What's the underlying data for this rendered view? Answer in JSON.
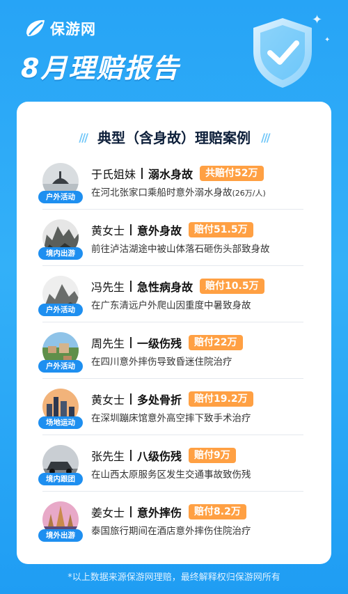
{
  "brand": {
    "name": "保游网"
  },
  "header": {
    "title": "8月理赔报告"
  },
  "section": {
    "title": "典型（含身故）理赔案例"
  },
  "cases": [
    {
      "name": "于氏姐妹",
      "cause": "溺水身故",
      "amount": "共赔付52万",
      "desc": "在河北张家口乘船时意外溺水身故",
      "note": "(26万/人)",
      "tag": "户外活动",
      "thumb": "boat-icon"
    },
    {
      "name": "黄女士",
      "cause": "意外身故",
      "amount": "赔付51.5万",
      "desc": "前往泸沽湖途中被山体落石砸伤头部致身故",
      "note": "",
      "tag": "境内出游",
      "thumb": "cliff-icon"
    },
    {
      "name": "冯先生",
      "cause": "急性病身故",
      "amount": "赔付10.5万",
      "desc": "在广东清远户外爬山因重度中暑致身故",
      "note": "",
      "tag": "户外活动",
      "thumb": "mountain-icon"
    },
    {
      "name": "周先生",
      "cause": "一级伤残",
      "amount": "赔付22万",
      "desc": "在四川意外摔伤导致昏迷住院治疗",
      "note": "",
      "tag": "户外活动",
      "thumb": "village-icon"
    },
    {
      "name": "黄女士",
      "cause": "多处骨折",
      "amount": "赔付19.2万",
      "desc": "在深圳蹦床馆意外高空摔下致手术治疗",
      "note": "",
      "tag": "场地运动",
      "thumb": "city-icon"
    },
    {
      "name": "张先生",
      "cause": "八级伤残",
      "amount": "赔付9万",
      "desc": "在山西太原服务区发生交通事故致伤残",
      "note": "",
      "tag": "境内跟团",
      "thumb": "car-icon"
    },
    {
      "name": "姜女士",
      "cause": "意外摔伤",
      "amount": "赔付8.2万",
      "desc": "泰国旅行期间在酒店意外摔伤住院治疗",
      "note": "",
      "tag": "境外出游",
      "thumb": "temple-icon"
    }
  ],
  "footer": {
    "note": "*以上数据来源保游网理赔，最终解释权归保游网所有"
  },
  "colors": {
    "background": "#27a4f6",
    "accent": "#1e8ff0",
    "amount": "#ffa043"
  }
}
